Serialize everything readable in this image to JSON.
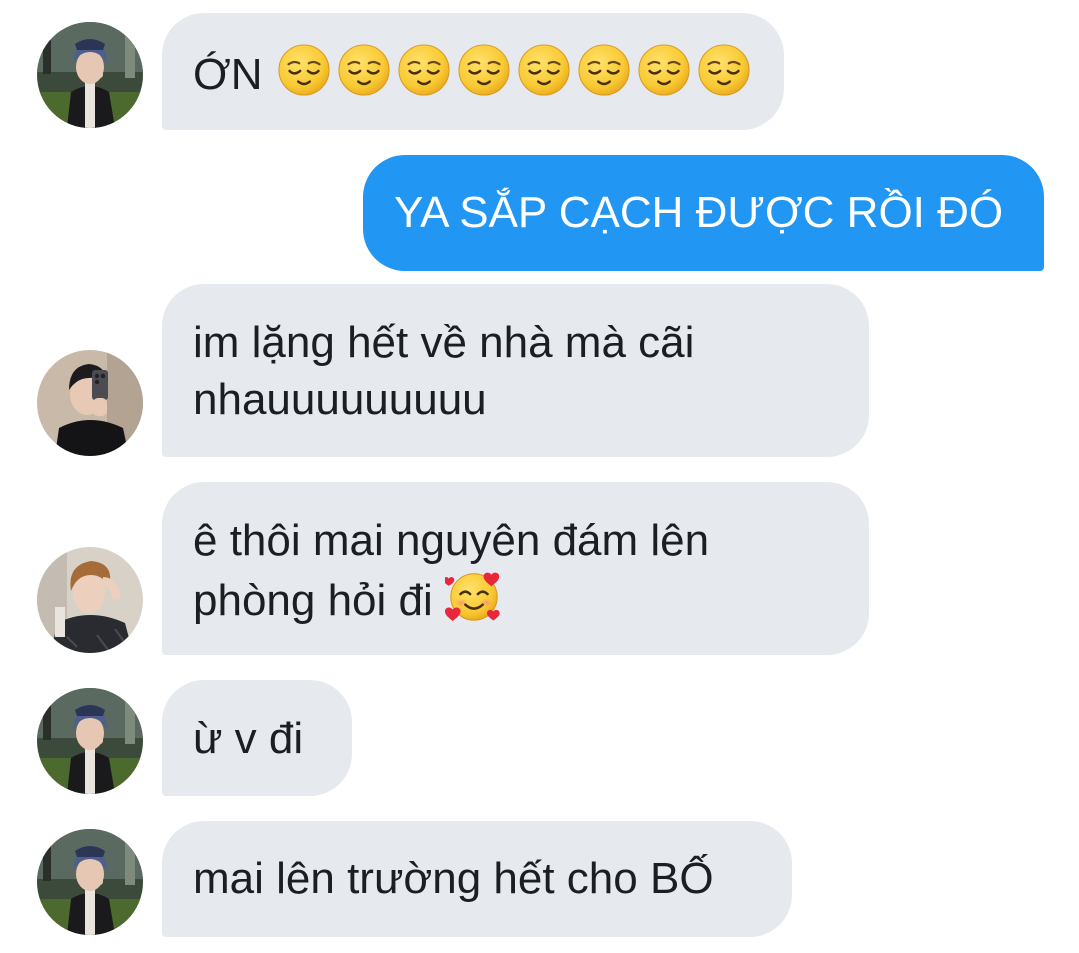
{
  "colors": {
    "incoming_bubble": "#e6eaef",
    "outgoing_bubble": "#2196f3",
    "incoming_text": "#1c1e21",
    "outgoing_text": "#ffffff"
  },
  "messages": [
    {
      "direction": "incoming",
      "avatar": "avatar-blue-hair-outdoor",
      "text": "ỚN",
      "emojis": [
        "relieved-face-emoji",
        "relieved-face-emoji",
        "relieved-face-emoji",
        "relieved-face-emoji",
        "relieved-face-emoji",
        "relieved-face-emoji",
        "relieved-face-emoji",
        "relieved-face-emoji"
      ]
    },
    {
      "direction": "outgoing",
      "text": "YA SẮP CẠCH ĐƯỢC RỒI ĐÓ"
    },
    {
      "direction": "incoming",
      "avatar": "avatar-mirror-selfie",
      "lines": [
        "im lặng hết về nhà mà cãi",
        "nhauuuuuuuuu"
      ]
    },
    {
      "direction": "incoming",
      "avatar": "avatar-hand-on-head",
      "lines": [
        "ê thôi mai nguyên đám lên",
        "phòng hỏi đi"
      ],
      "emojis": [
        "smiling-face-with-hearts-emoji"
      ]
    },
    {
      "direction": "incoming",
      "avatar": "avatar-blue-hair-outdoor",
      "text": "ừ v đi"
    },
    {
      "direction": "incoming",
      "avatar": "avatar-blue-hair-outdoor",
      "text": "mai lên trường hết cho BỐ"
    }
  ]
}
